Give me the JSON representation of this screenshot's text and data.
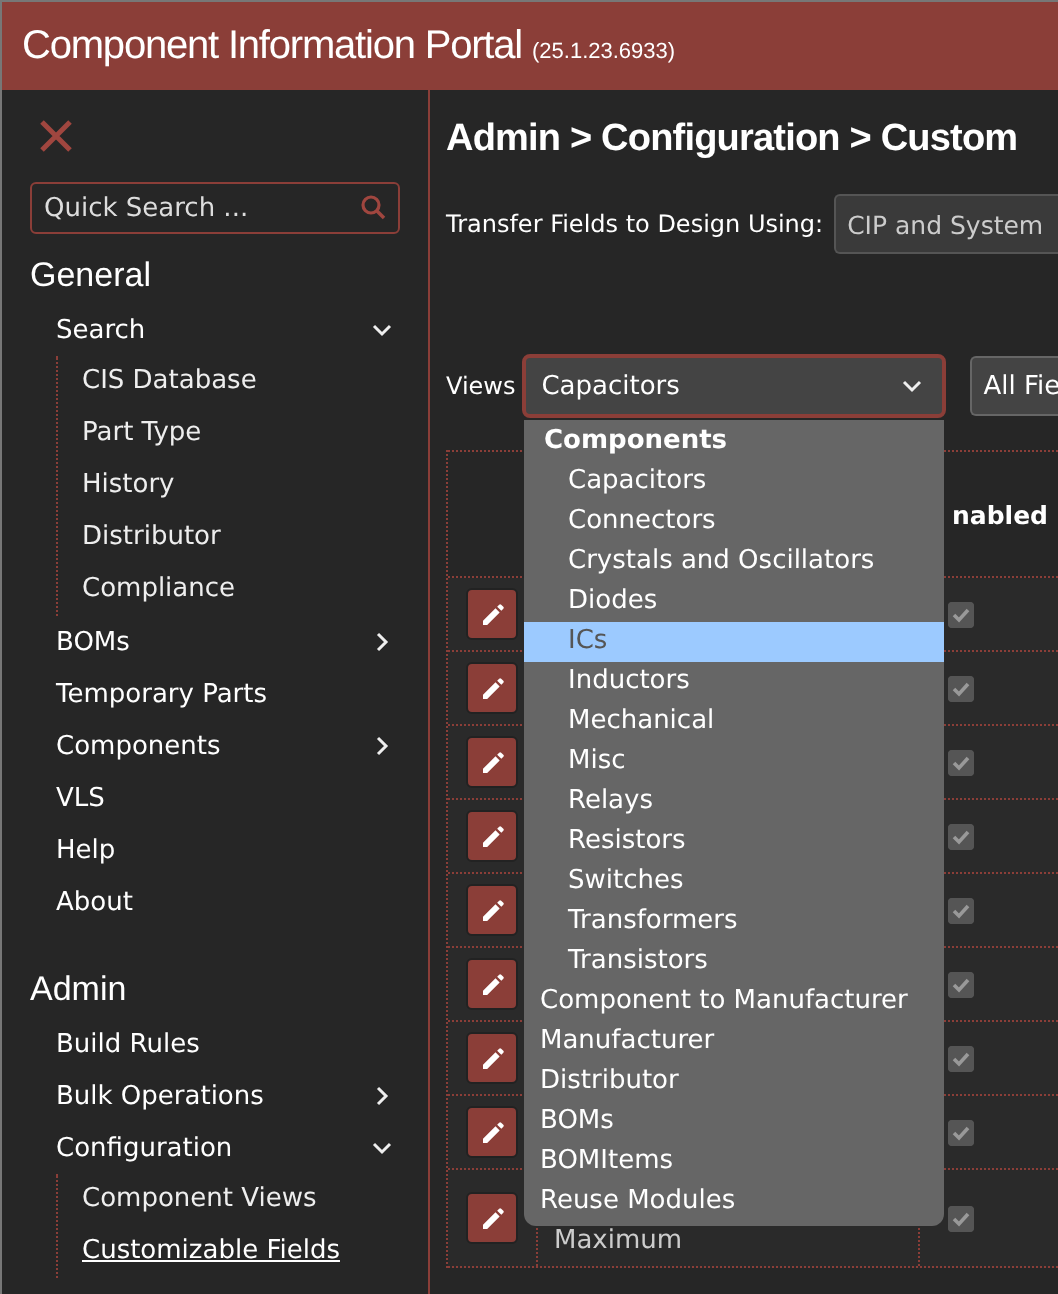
{
  "header": {
    "title": "Component Information Portal",
    "version": "(25.1.23.6933)"
  },
  "sidebar": {
    "search": {
      "placeholder": "Quick Search ..."
    },
    "sections": [
      {
        "title": "General",
        "items": [
          {
            "label": "Search",
            "selected": false,
            "expanded": true,
            "children": [
              {
                "label": "CIS Database",
                "selected": false
              },
              {
                "label": "Part Type",
                "selected": false
              },
              {
                "label": "History",
                "selected": false
              },
              {
                "label": "Distributor",
                "selected": false
              },
              {
                "label": "Compliance",
                "selected": false
              }
            ]
          },
          {
            "label": "BOMs",
            "selected": false,
            "expanded": false
          },
          {
            "label": "Temporary Parts",
            "selected": false
          },
          {
            "label": "Components",
            "selected": false,
            "expanded": false
          },
          {
            "label": "VLS",
            "selected": false
          },
          {
            "label": "Help",
            "selected": false
          },
          {
            "label": "About",
            "selected": false
          }
        ]
      },
      {
        "title": "Admin",
        "items": [
          {
            "label": "Build Rules",
            "selected": false
          },
          {
            "label": "Bulk Operations",
            "selected": false,
            "expanded": false
          },
          {
            "label": "Configuration",
            "selected": false,
            "expanded": true,
            "children": [
              {
                "label": "Component Views",
                "selected": false
              },
              {
                "label": "Customizable Fields",
                "selected": true
              }
            ]
          }
        ]
      }
    ]
  },
  "main": {
    "breadcrumb": "Admin > Configuration > Custom",
    "transfer": {
      "label": "Transfer Fields to Design Using:",
      "value": "CIP and System"
    },
    "views": {
      "label": "Views",
      "value": "Capacitors",
      "filter_value": "All Fie",
      "options": [
        {
          "kind": "group",
          "label": "Components",
          "children": [
            {
              "label": "Capacitors",
              "selected": false
            },
            {
              "label": "Connectors",
              "selected": false
            },
            {
              "label": "Crystals and Oscillators",
              "selected": false
            },
            {
              "label": "Diodes",
              "selected": false
            },
            {
              "label": "ICs",
              "selected": true
            },
            {
              "label": "Inductors",
              "selected": false
            },
            {
              "label": "Mechanical",
              "selected": false
            },
            {
              "label": "Misc",
              "selected": false
            },
            {
              "label": "Relays",
              "selected": false
            },
            {
              "label": "Resistors",
              "selected": false
            },
            {
              "label": "Switches",
              "selected": false
            },
            {
              "label": "Transformers",
              "selected": false
            },
            {
              "label": "Transistors",
              "selected": false
            }
          ]
        },
        {
          "kind": "option",
          "label": "Component to Manufacturer",
          "selected": false
        },
        {
          "kind": "option",
          "label": "Manufacturer",
          "selected": false
        },
        {
          "kind": "option",
          "label": "Distributor",
          "selected": false
        },
        {
          "kind": "option",
          "label": "BOMs",
          "selected": false
        },
        {
          "kind": "option",
          "label": "BOMItems",
          "selected": false
        },
        {
          "kind": "option",
          "label": "Reuse Modules",
          "selected": false
        }
      ]
    },
    "table": {
      "enabled_header": "nabled",
      "rows": [
        {
          "checked": true
        },
        {
          "checked": true
        },
        {
          "checked": true
        },
        {
          "checked": true
        },
        {
          "checked": true
        },
        {
          "checked": true
        },
        {
          "checked": true
        },
        {
          "checked": true
        },
        {
          "name": "Maximum",
          "checked": true
        }
      ]
    }
  }
}
